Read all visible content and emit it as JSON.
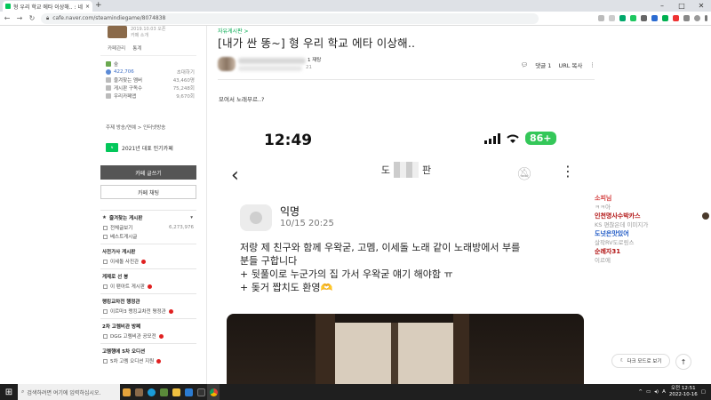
{
  "browser": {
    "tab_title": "형 우리 학교 에타 이상해.. : 네이",
    "new_tab_label": "+",
    "url": "cafe.naver.com/steamindiegame/8074838"
  },
  "sidebar": {
    "brand_line": "2019.10.03 오픈",
    "brand_line2": "카페 소개",
    "manage_label": "카페관리",
    "stats_label": "통계",
    "rank_label": "숲",
    "members": "422,706",
    "invite_label": "초대하기",
    "fav_members_label": "즐겨찾는 멤버",
    "fav_members_num": "43,460명",
    "mygrade_label": "게시판 구독수",
    "mygrade_num": "75,248회",
    "visits_label": "우리카페앱",
    "visits_num": "9,670회",
    "theme_line": "주제 방송/연예 > 인터넷방송",
    "award_line": "2021년 대표 인기카페",
    "write_button": "카페 글쓰기",
    "chat_button": "카페 채팅",
    "fav_boards_title": "즐겨찾는 게시판",
    "boards": [
      {
        "label": "전체글보기",
        "num": "6,273,976"
      },
      {
        "label": "베스트게시글",
        "num": ""
      }
    ],
    "sections": [
      {
        "title": "사전가사 게시판",
        "items": [
          "이세돌 사진관"
        ]
      },
      {
        "title": "게제로 선 봉",
        "items": [
          "이 팬아트 게시판"
        ]
      },
      {
        "title": "랭킹교차전 행정관",
        "items": [
          "이르마3 랭킹교차전 평정관"
        ]
      },
      {
        "title": "2차 고렘비관 방폐",
        "items": [
          "DGG 고렘비관 공모전"
        ]
      },
      {
        "title": "고렘행에 5차 오디션",
        "items": [
          "5차 고렘 오디션 지원"
        ]
      }
    ]
  },
  "article": {
    "breadcrumb": "자유게시판 >",
    "title": "[내가 싼 똥~] 형 우리 학교 에타 이상해..",
    "author_level": "1 재탕",
    "views": "21",
    "comments_label": "댓글 1",
    "url_copy_label": "URL 복사",
    "body_line": "모여서 노래부르..?"
  },
  "phone": {
    "time": "12:49",
    "battery": "86+",
    "anon_name": "익명",
    "date": "10/15 20:25",
    "post_lines": [
      "저랑 제 친구와 함께 우왁굳, 고멤, 이세돌 노래 같이 노래방에서 부를",
      "분들 구합니다",
      "+ 뒷풀이로 누군가의 집 가서 우왁굳 얘기 해야함 ㅠ",
      "+ 돚거 짭치도 환영🫶"
    ],
    "header_fragment_left": "도",
    "header_fragment_right": "판"
  },
  "chat": [
    {
      "name": "소피님",
      "msg": "ㅋㅋ아",
      "color": "#d33b3b"
    },
    {
      "name": "인천명사수박카스",
      "msg": "KS 편찮은데 이미지가",
      "color": "#b01010"
    },
    {
      "name": "도넛은맛있어",
      "msg": "살작RV도로링스",
      "color": "#1a56c4"
    },
    {
      "name": "순례자31",
      "msg": "이르에",
      "color": "#b01010"
    }
  ],
  "floating": {
    "dark_mode": "다크 모드로 보기",
    "top": "↑"
  },
  "taskbar": {
    "search_placeholder": "검색하려면 여기에 입력하십시오.",
    "time": "오전 12:51",
    "date": "2022-10-16"
  }
}
